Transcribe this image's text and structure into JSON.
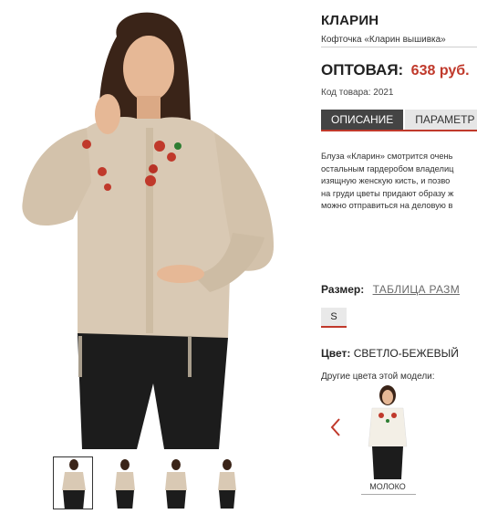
{
  "product": {
    "title": "КЛАРИН",
    "subtitle": "Кофточка «Кларин вышивка»",
    "price_label": "ОПТОВАЯ:",
    "price_value": "638 руб.",
    "code_label": "Код товара: 2021"
  },
  "tabs": [
    {
      "label": "ОПИСАНИЕ",
      "active": true
    },
    {
      "label": "ПАРАМЕТР",
      "active": false
    }
  ],
  "description": [
    "Блуза «Кларин» смотрится очень",
    "остальным гардеробом владелиц",
    "изящную женскую кисть, и позво",
    "на груди цветы придают образу ж",
    "можно отправиться на деловую в"
  ],
  "size": {
    "label": "Размер:",
    "table_link": "ТАБЛИЦА РАЗМ",
    "options": [
      "S"
    ]
  },
  "color": {
    "label": "Цвет:",
    "value": "СВЕТЛО-БЕЖЕВЫЙ",
    "other_label": "Другие цвета этой модели:",
    "alternatives": [
      {
        "name": "МОЛОКО"
      }
    ]
  },
  "colors": {
    "accent": "#c0392b",
    "blouse": "#d9c9b4",
    "blouse_milk": "#f3efe6",
    "pants": "#1c1c1c",
    "tab_active": "#444444"
  },
  "icons": [
    "chevron-left-icon"
  ]
}
